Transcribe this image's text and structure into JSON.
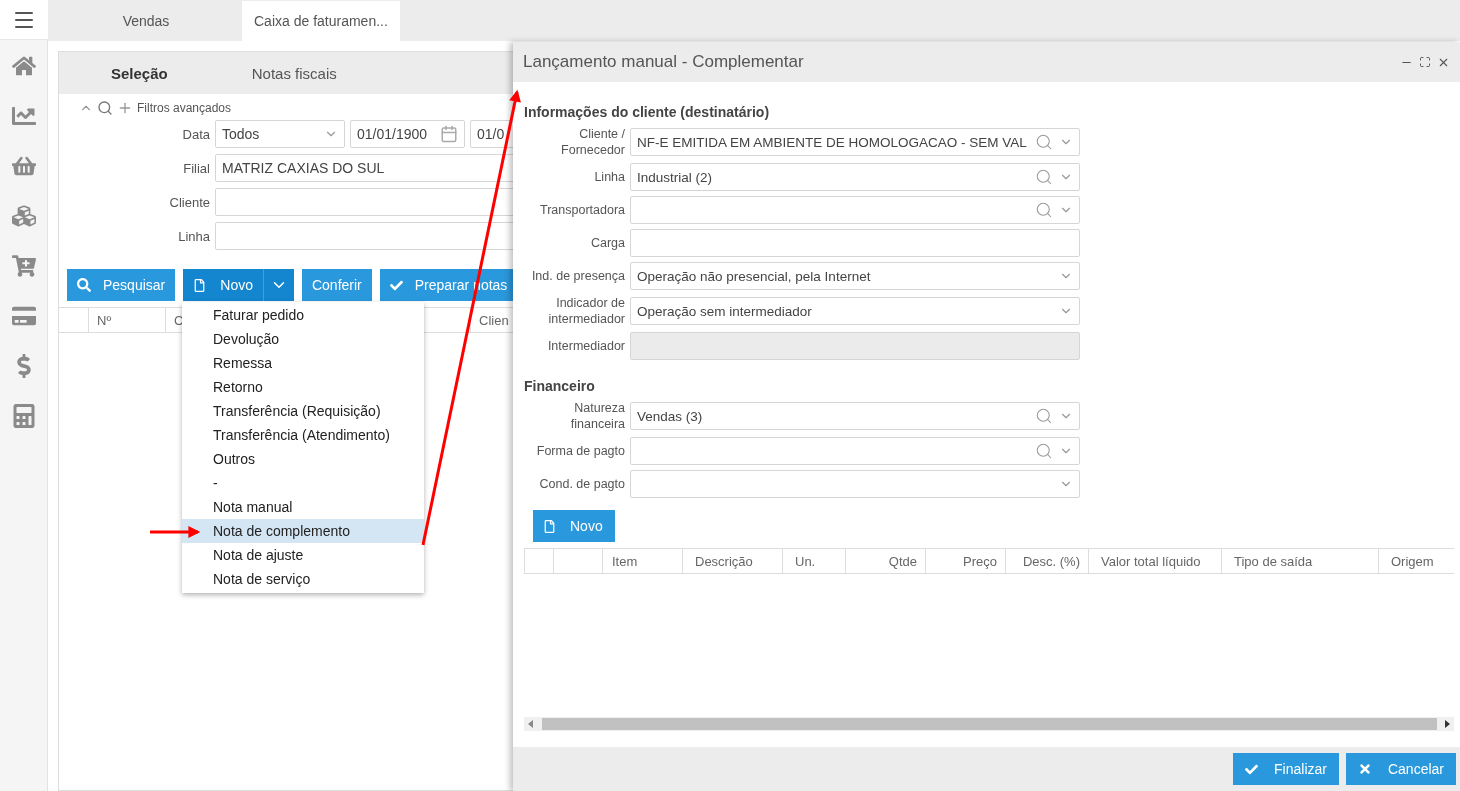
{
  "tabs": [
    {
      "label": "Vendas",
      "selected": false
    },
    {
      "label": "Caixa de faturamen...",
      "selected": true
    }
  ],
  "page": {
    "subtabs": [
      {
        "label": "Seleção",
        "selected": true
      },
      {
        "label": "Notas fiscais",
        "selected": false
      }
    ],
    "filters_label": "Filtros avançados",
    "date_row": {
      "label": "Data",
      "period": "Todos",
      "from": "01/01/1900",
      "to": "01/0"
    },
    "fields": [
      {
        "label": "Filial",
        "value": "MATRIZ CAXIAS DO SUL"
      },
      {
        "label": "Cliente"
      },
      {
        "label": "Linha"
      }
    ],
    "buttons": [
      {
        "label": "Pesquisar",
        "kind": "search"
      },
      {
        "label": "Novo",
        "kind": "split"
      },
      {
        "label": "Conferir",
        "kind": "plain"
      },
      {
        "label": "Preparar notas",
        "kind": "check"
      }
    ],
    "table": {
      "columns": [
        "Nº",
        "C",
        "Clien"
      ]
    },
    "menu": {
      "items": [
        {
          "label": "Faturar pedido",
          "selected": false
        },
        {
          "label": "Devolução",
          "selected": false
        },
        {
          "label": "Remessa",
          "selected": false
        },
        {
          "label": "Retorno",
          "selected": false
        },
        {
          "label": "Transferência (Requisição)",
          "selected": false
        },
        {
          "label": "Transferência (Atendimento)",
          "selected": false
        },
        {
          "label": "Outros",
          "selected": false
        },
        {
          "label": "-",
          "selected": false
        },
        {
          "label": "Nota manual",
          "selected": false
        },
        {
          "label": "Nota de complemento",
          "selected": true
        },
        {
          "label": "Nota de ajuste",
          "selected": false
        },
        {
          "label": "Nota de serviço",
          "selected": false
        }
      ]
    }
  },
  "modal": {
    "title": "Lançamento manual - Complementar",
    "sections": [
      {
        "title": "Informações do cliente (destinatário)",
        "fields": [
          {
            "label": "Cliente / Fornecedor",
            "value": "NF-E EMITIDA EM AMBIENTE DE HOMOLOGACAO - SEM VAL",
            "kind": "lookup"
          },
          {
            "label": "Linha",
            "value": "Industrial (2)",
            "kind": "lookup"
          },
          {
            "label": "Transportadora",
            "kind": "lookup"
          },
          {
            "label": "Carga",
            "kind": "text"
          },
          {
            "label": "Ind. de presença",
            "value": "Operação não presencial, pela Internet",
            "kind": "select"
          },
          {
            "label": "Indicador de intermediador",
            "value": "Operação sem intermediador",
            "kind": "select"
          },
          {
            "label": "Intermediador",
            "kind": "disabled"
          }
        ]
      },
      {
        "title": "Financeiro",
        "fields": [
          {
            "label": "Natureza financeira",
            "value": "Vendas (3)",
            "kind": "lookup"
          },
          {
            "label": "Forma de pagto",
            "kind": "lookup"
          },
          {
            "label": "Cond. de pagto",
            "kind": "select"
          }
        ]
      }
    ],
    "new_button": "Novo",
    "table": {
      "columns": [
        "Item",
        "Descrição",
        "Un.",
        "Qtde",
        "Preço",
        "Desc. (%)",
        "Valor total líquido",
        "Tipo de saída",
        "Origem"
      ]
    },
    "footer_buttons": [
      {
        "label": "Finalizar",
        "kind": "check"
      },
      {
        "label": "Cancelar",
        "kind": "close"
      }
    ]
  }
}
